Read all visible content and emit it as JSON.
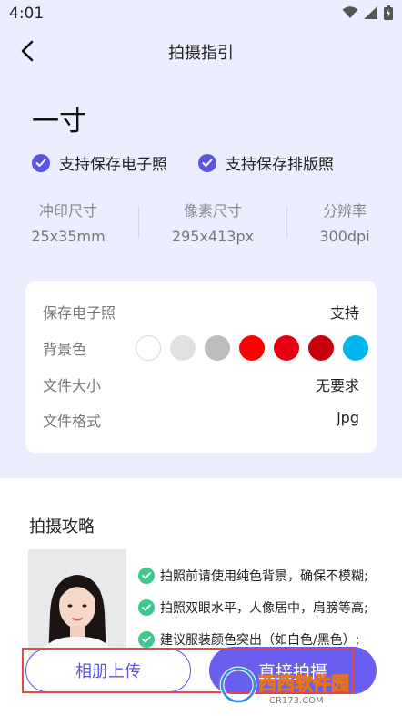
{
  "status_bar": {
    "time": "4:01"
  },
  "nav": {
    "title": "拍摄指引"
  },
  "size": {
    "title": "一寸",
    "supports": [
      "支持保存电子照",
      "支持保存排版照"
    ]
  },
  "specs": [
    {
      "label": "冲印尺寸",
      "value": "25x35mm"
    },
    {
      "label": "像素尺寸",
      "value": "295x413px"
    },
    {
      "label": "分辨率",
      "value": "300dpi"
    }
  ],
  "details": {
    "save_electronic": {
      "label": "保存电子照",
      "value": "支持"
    },
    "background": {
      "label": "背景色",
      "colors": [
        "#ffffff",
        "#e0e0e0",
        "#bdbbbb",
        "#ff0000",
        "#e60012",
        "#c8000b",
        "#00b4f0"
      ]
    },
    "file_size": {
      "label": "文件大小",
      "value": "无要求"
    },
    "file_format": {
      "label": "文件格式",
      "value": "jpg"
    }
  },
  "guide": {
    "title": "拍摄攻略",
    "tips": [
      "拍照前请使用纯色背景，确保不模糊;",
      "拍照双眼水平，人像居中，肩膀等高;",
      "建议服装颜色突出（如白色/黑色）;"
    ]
  },
  "actions": {
    "album_upload": "相册上传",
    "shoot_direct": "直接拍摄"
  },
  "watermark": {
    "brand": "西西软件园",
    "site": "CR173.COM"
  },
  "colors": {
    "accent": "#5b55e0",
    "top_background": "#ecedff",
    "tip_check": "#3dc88e",
    "highlight": "#e24848"
  }
}
